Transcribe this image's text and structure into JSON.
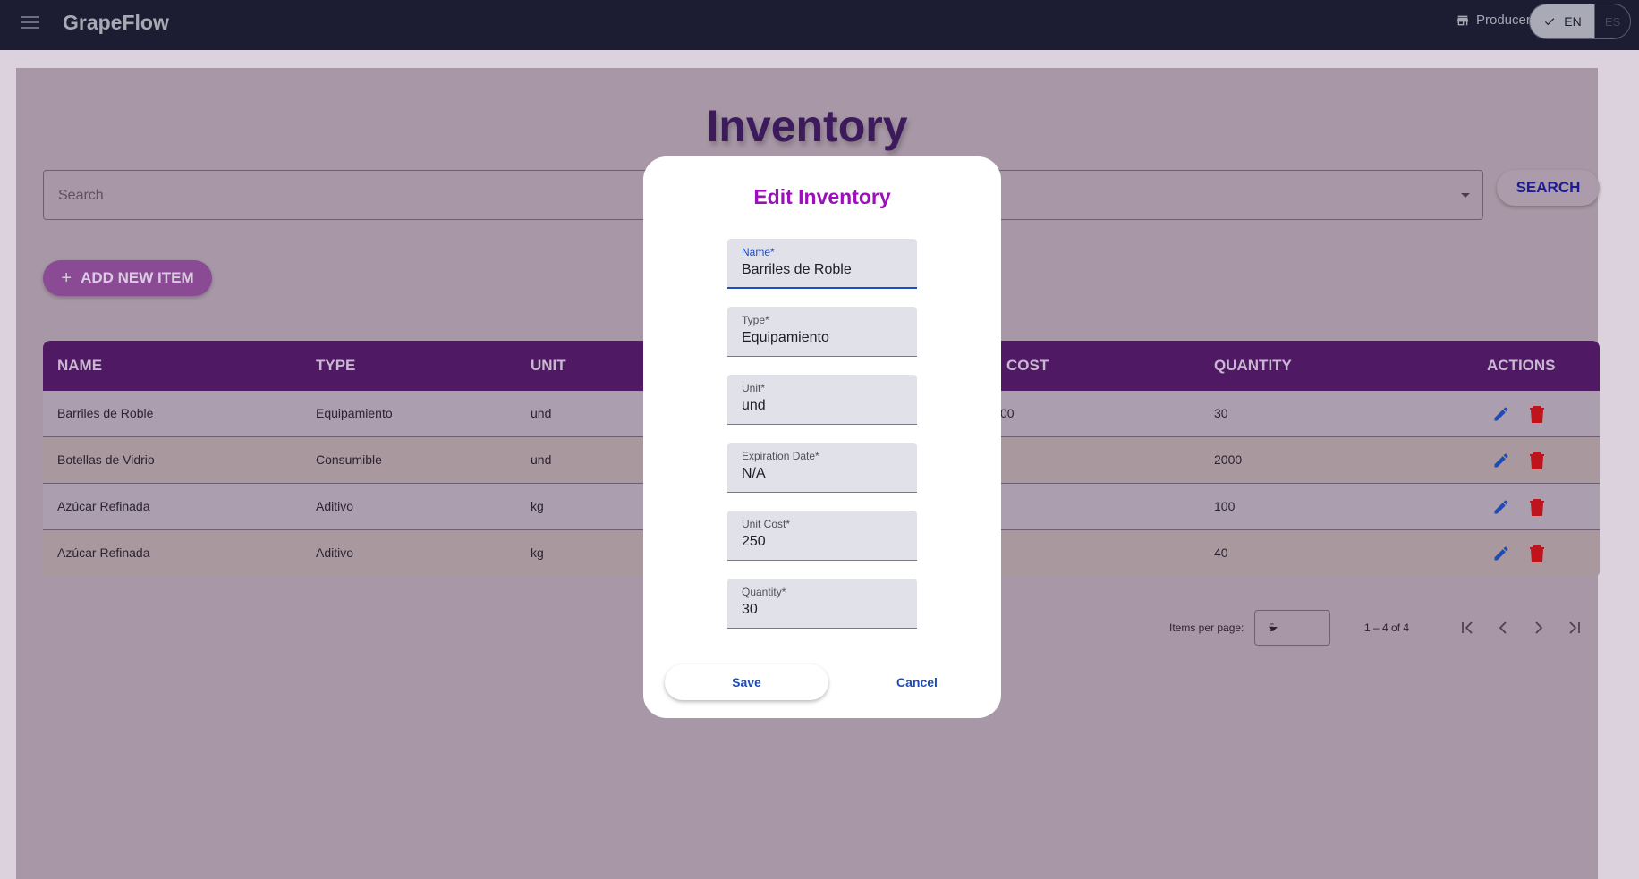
{
  "app": {
    "brand": "GrapeFlow"
  },
  "header": {
    "user_role": "Producer",
    "languages": [
      {
        "code": "EN",
        "selected": true
      },
      {
        "code": "ES",
        "selected": false
      }
    ]
  },
  "page": {
    "title": "Inventory",
    "search_placeholder": "Search",
    "search_button": "SEARCH",
    "add_button": "ADD NEW ITEM"
  },
  "table": {
    "columns": [
      "NAME",
      "TYPE",
      "UNIT",
      "COST",
      "QUANTITY",
      "ACTIONS"
    ],
    "rows": [
      {
        "name": "Barriles de Roble",
        "type": "Equipamiento",
        "unit": "und",
        "cost_partial": "00",
        "quantity": "30"
      },
      {
        "name": "Botellas de Vidrio",
        "type": "Consumible",
        "unit": "und",
        "cost_partial": "",
        "quantity": "2000"
      },
      {
        "name": "Azúcar Refinada",
        "type": "Aditivo",
        "unit": "kg",
        "cost_partial": "",
        "quantity": "100"
      },
      {
        "name": "Azúcar Refinada",
        "type": "Aditivo",
        "unit": "kg",
        "cost_partial": "",
        "quantity": "40"
      }
    ]
  },
  "paginator": {
    "items_per_page_label": "Items per page:",
    "items_per_page": "5",
    "range": "1 – 4 of 4"
  },
  "modal": {
    "title": "Edit Inventory",
    "fields": [
      {
        "label": "Name*",
        "value": "Barriles de Roble"
      },
      {
        "label": "Type*",
        "value": "Equipamiento"
      },
      {
        "label": "Unit*",
        "value": "und"
      },
      {
        "label": "Expiration Date*",
        "value": "N/A"
      },
      {
        "label": "Unit Cost*",
        "value": "250"
      },
      {
        "label": "Quantity*",
        "value": "30"
      }
    ],
    "save_label": "Save",
    "cancel_label": "Cancel"
  },
  "colors": {
    "header_bg": "#1c1d33",
    "table_header": "#4f1964",
    "modal_title": "#9b10b8",
    "accent_blue": "#1d4bb8",
    "delete_red": "#c0141c"
  }
}
